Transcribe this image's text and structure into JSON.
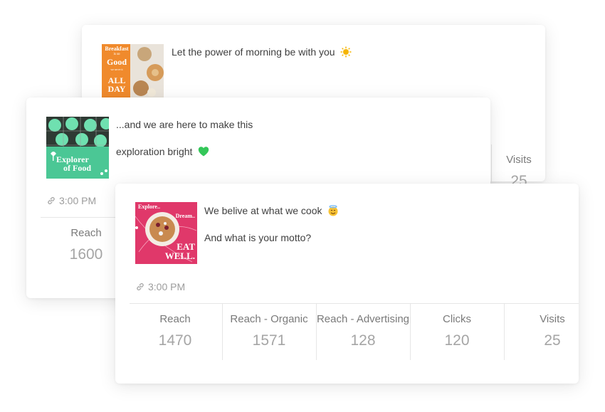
{
  "posts": [
    {
      "caption_lines": [
        "Let the power of morning be with you"
      ],
      "emoji": "sun-icon",
      "thumb_text": [
        "Breakfast",
        "is so",
        "Good",
        "we serve it",
        "ALL",
        "DAY"
      ],
      "stats": [
        {
          "label": "Visits",
          "value": "25"
        }
      ]
    },
    {
      "caption_lines": [
        "...and we are here to make this",
        "exploration bright"
      ],
      "emoji": "green-heart-icon",
      "thumb_text": [
        "Explorer",
        "of Food"
      ],
      "time": "3:00 PM",
      "stats": [
        {
          "label": "Reach",
          "value": "1600"
        }
      ]
    },
    {
      "caption_lines": [
        "We belive at what we cook",
        "And what is your motto?"
      ],
      "emoji": "smiling-halo-icon",
      "thumb_text": [
        "Explore..",
        "Dream..",
        "EAT",
        "WELL."
      ],
      "time": "3:00 PM",
      "stats": [
        {
          "label": "Reach",
          "value": "1470"
        },
        {
          "label": "Reach - Organic",
          "value": "1571"
        },
        {
          "label": "Reach - Advertising",
          "value": "128"
        },
        {
          "label": "Clicks",
          "value": "120"
        },
        {
          "label": "Visits",
          "value": "25"
        }
      ]
    }
  ],
  "colors": {
    "orange": "#f08a2c",
    "mint": "#4bc795",
    "pink": "#e0386a",
    "green_heart": "#34c759",
    "sun": "#f5b400"
  }
}
